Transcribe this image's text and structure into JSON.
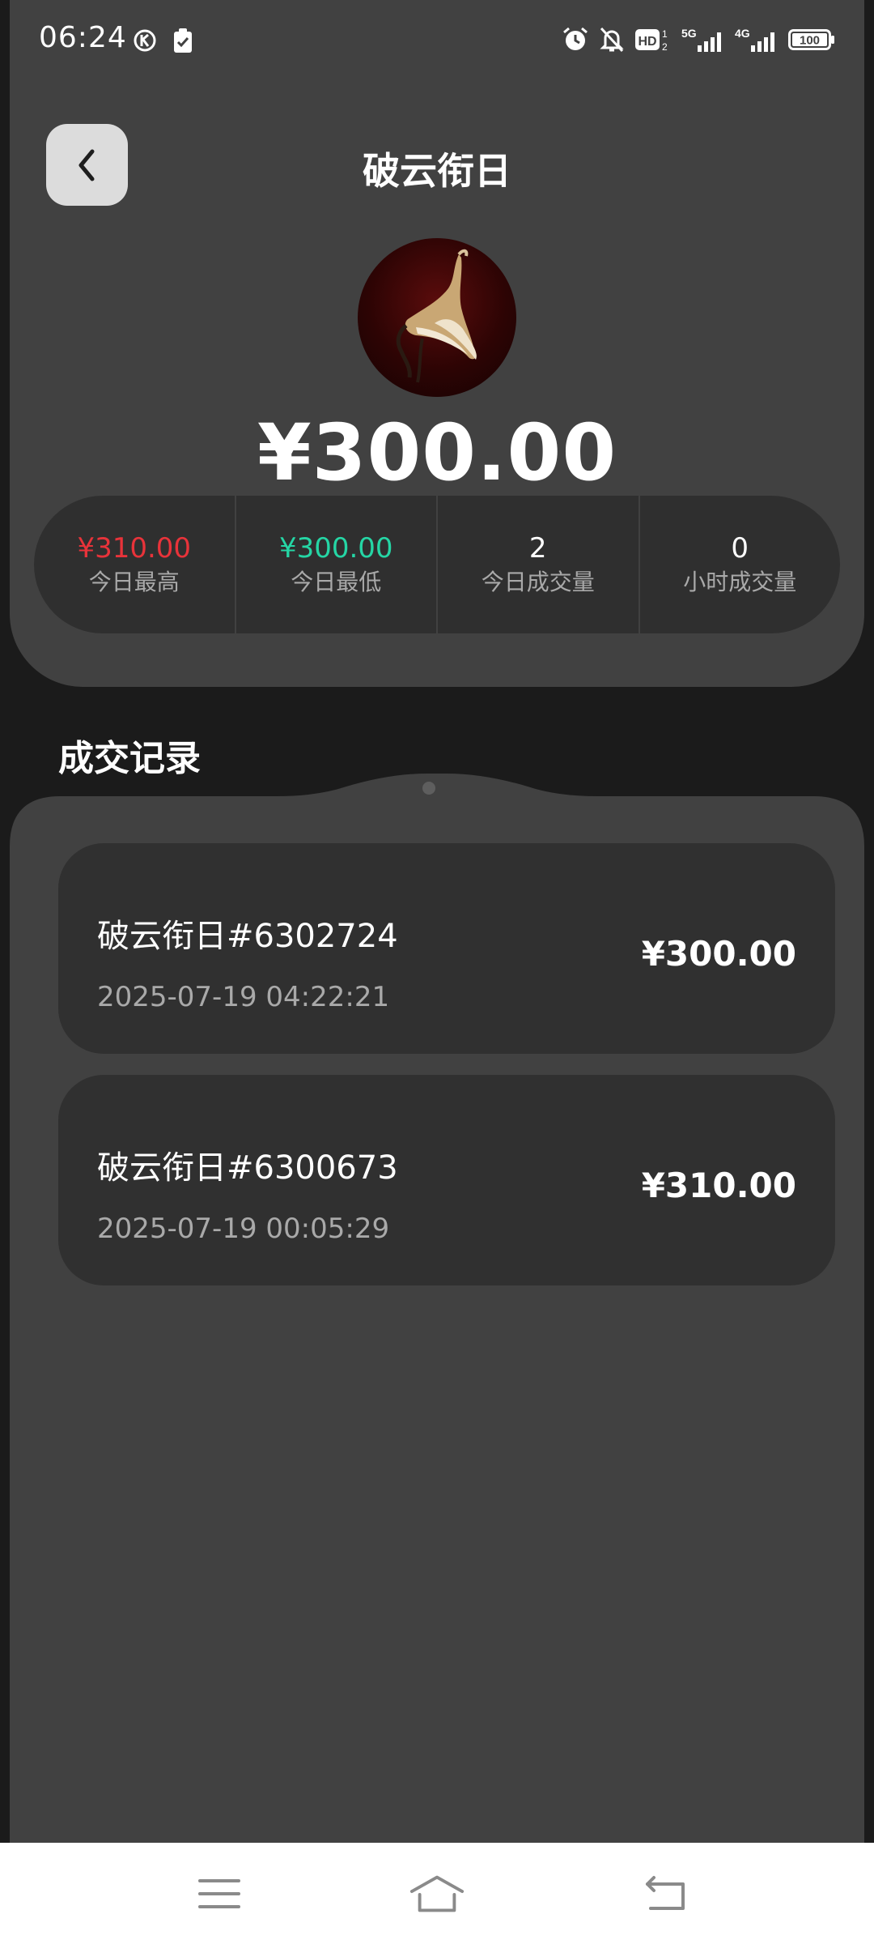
{
  "status_bar": {
    "time": "06:24",
    "network_1": "5G",
    "network_2": "4G",
    "battery": "100",
    "hd_label": "HD"
  },
  "header": {
    "title": "破云衔日",
    "price": "¥300.00"
  },
  "stats": [
    {
      "value": "¥310.00",
      "label": "今日最高",
      "color": "#e8333a"
    },
    {
      "value": "¥300.00",
      "label": "今日最低",
      "color": "#25d6a5"
    },
    {
      "value": "2",
      "label": "今日成交量",
      "color": "#ffffff"
    },
    {
      "value": "0",
      "label": "小时成交量",
      "color": "#ffffff"
    }
  ],
  "records": {
    "title": "成交记录",
    "items": [
      {
        "name": "破云衔日#6302724",
        "time": "2025-07-19 04:22:21",
        "price": "¥300.00"
      },
      {
        "name": "破云衔日#6300673",
        "time": "2025-07-19 00:05:29",
        "price": "¥310.00"
      }
    ]
  },
  "icons": {
    "back": "chevron-left-icon",
    "menu": "menu-icon",
    "home": "home-icon",
    "return": "back-arrow-icon"
  },
  "colors": {
    "panel": "#414141",
    "card": "#303030",
    "background": "#1b1b1b",
    "price_high": "#e8333a",
    "price_low": "#25d6a5"
  }
}
